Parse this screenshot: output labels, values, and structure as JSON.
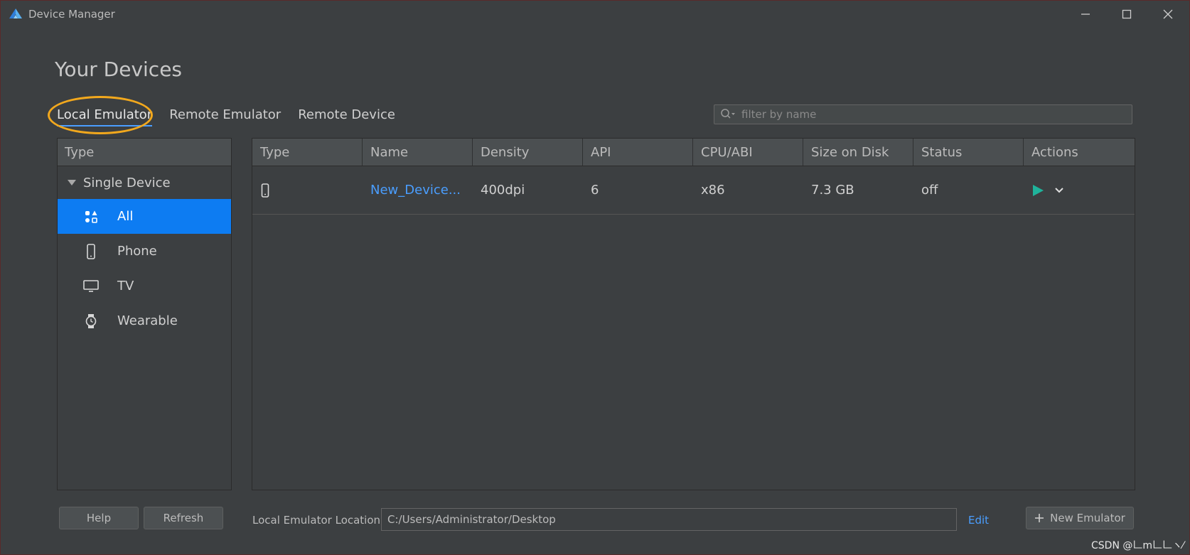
{
  "window": {
    "title": "Device Manager",
    "controls": [
      "minimize-icon",
      "maximize-icon",
      "close-icon"
    ]
  },
  "page_title": "Your Devices",
  "tabs": [
    {
      "label": "Local Emulator",
      "active": true
    },
    {
      "label": "Remote Emulator",
      "active": false
    },
    {
      "label": "Remote Device",
      "active": false
    }
  ],
  "search": {
    "placeholder": "filter by name",
    "value": ""
  },
  "sidebar": {
    "header": "Type",
    "group": "Single Device",
    "items": [
      {
        "label": "All",
        "icon": "grid-apps-icon",
        "selected": true
      },
      {
        "label": "Phone",
        "icon": "phone-icon",
        "selected": false
      },
      {
        "label": "TV",
        "icon": "tv-icon",
        "selected": false
      },
      {
        "label": "Wearable",
        "icon": "watch-icon",
        "selected": false
      }
    ]
  },
  "table": {
    "columns": [
      "Type",
      "Name",
      "Density",
      "API",
      "CPU/ABI",
      "Size on Disk",
      "Status",
      "Actions"
    ],
    "rows": [
      {
        "type_icon": "phone-icon",
        "name": "New_Device...",
        "density": "400dpi",
        "api": "6",
        "cpu": "x86",
        "size": "7.3 GB",
        "status": "off"
      }
    ]
  },
  "footer": {
    "help_label": "Help",
    "refresh_label": "Refresh",
    "location_label": "Local Emulator Location:",
    "location_value": "C:/Users/Administrator/Desktop",
    "edit_label": "Edit",
    "new_emulator_label": "New Emulator"
  },
  "watermark": "CSDN @𠃊m𠃊𠃊ヽ⁄",
  "colors": {
    "accent": "#0d7cf2",
    "link": "#4a9eff",
    "play": "#1fb39b",
    "highlight_circle": "#f2a81d"
  }
}
